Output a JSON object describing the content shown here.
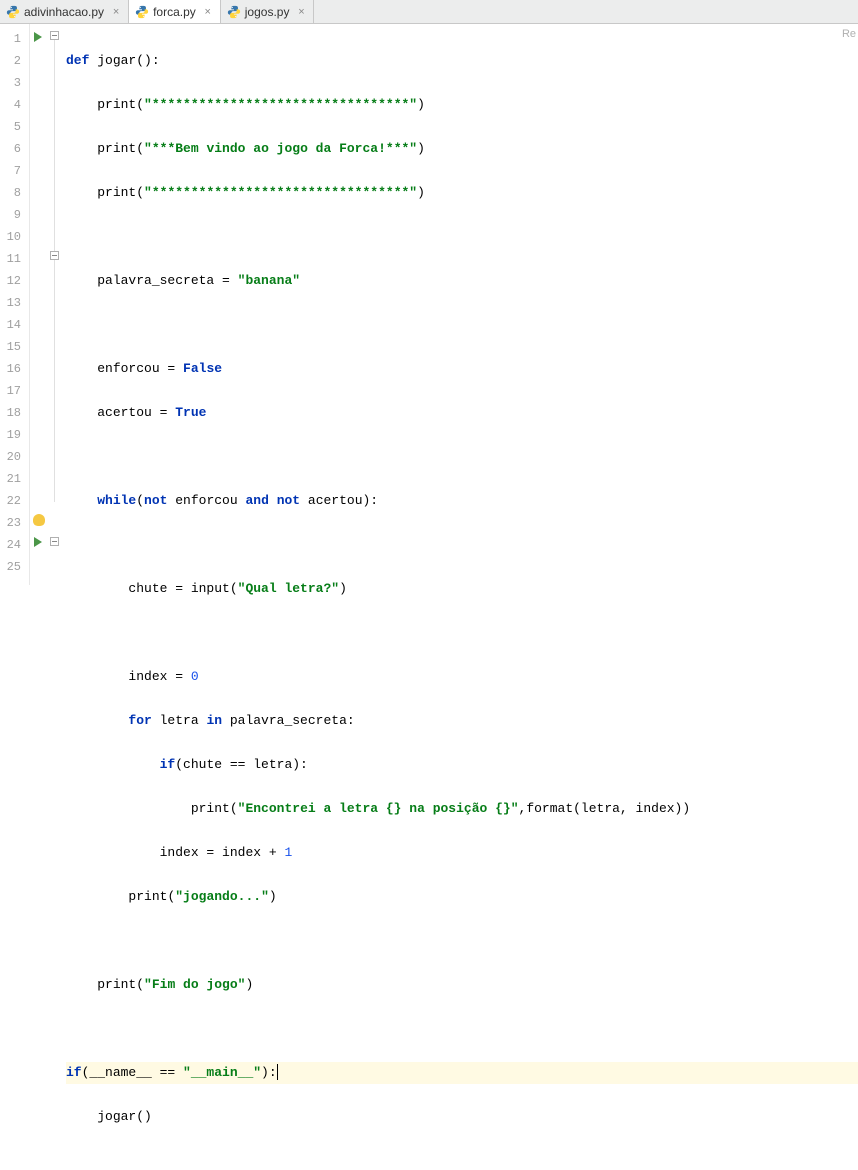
{
  "tabs": [
    {
      "label": "adivinhacao.py",
      "active": false
    },
    {
      "label": "forca.py",
      "active": true
    },
    {
      "label": "jogos.py",
      "active": false
    }
  ],
  "right_hint": "Re",
  "gutter": [
    "1",
    "2",
    "3",
    "4",
    "5",
    "6",
    "7",
    "8",
    "9",
    "10",
    "11",
    "12",
    "13",
    "14",
    "15",
    "16",
    "17",
    "18",
    "19",
    "20",
    "21",
    "22",
    "23",
    "24",
    "25"
  ],
  "code": {
    "l1": {
      "def": "def",
      "fn": "jogar",
      "paren": "():"
    },
    "l2": {
      "print": "print",
      "open": "(",
      "str": "\"*********************************\"",
      "close": ")"
    },
    "l3": {
      "print": "print",
      "open": "(",
      "str": "\"***Bem vindo ao jogo da Forca!***\"",
      "close": ")"
    },
    "l4": {
      "print": "print",
      "open": "(",
      "str": "\"*********************************\"",
      "close": ")"
    },
    "l6": {
      "var": "palavra_secreta = ",
      "str": "\"banana\""
    },
    "l8": {
      "var": "enforcou = ",
      "kw": "False"
    },
    "l9": {
      "var": "acertou = ",
      "kw": "True"
    },
    "l11": {
      "kw1": "while",
      "p1": "(",
      "kw2": "not",
      "v1": " enforcou ",
      "kw3": "and",
      "sp": " ",
      "kw4": "not",
      "v2": " acertou):"
    },
    "l13": {
      "var": "chute = input(",
      "str": "\"Qual letra?\"",
      "close": ")"
    },
    "l15": {
      "var": "index = ",
      "num": "0"
    },
    "l16": {
      "kw1": "for",
      "v1": " letra ",
      "kw2": "in",
      "v2": " palavra_secreta:"
    },
    "l17": {
      "kw": "if",
      "rest": "(chute == letra):"
    },
    "l18": {
      "print": "print",
      "open": "(",
      "str": "\"Encontrei a letra {} na posição {}\"",
      "mid": ",format(letra, index))"
    },
    "l19": {
      "var": "index = index + ",
      "num": "1"
    },
    "l20": {
      "print": "print",
      "open": "(",
      "str": "\"jogando...\"",
      "close": ")"
    },
    "l22": {
      "print": "print",
      "open": "(",
      "str": "\"Fim do jogo\"",
      "close": ")"
    },
    "l24": {
      "kw": "if",
      "p1": "(__name__ == ",
      "str": "\"__main__\"",
      "p2": "):"
    },
    "l25": {
      "call": "jogar()"
    }
  }
}
